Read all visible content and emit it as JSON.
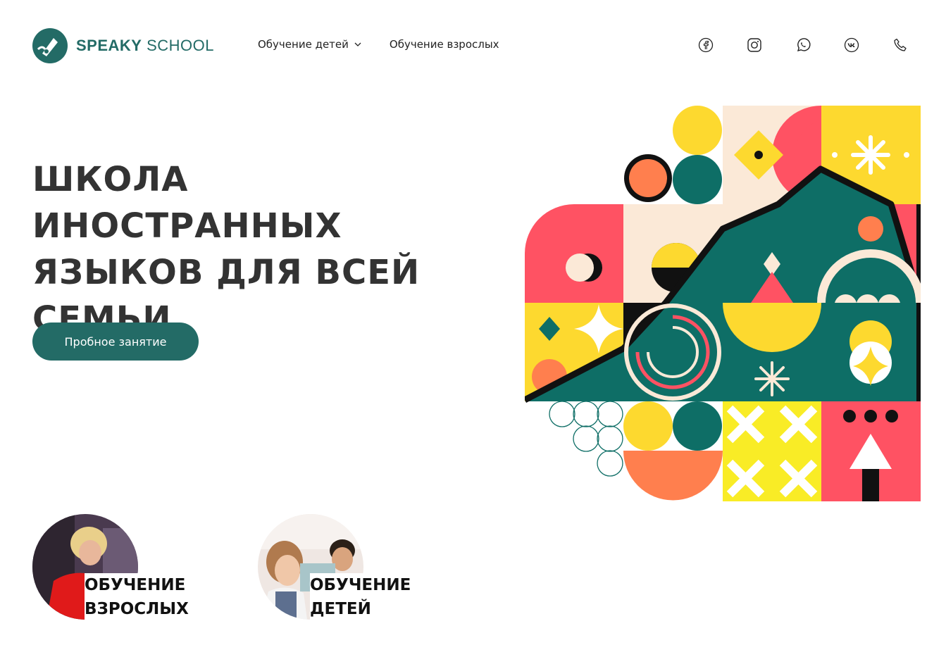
{
  "brand": {
    "name_bold": "SPEAKY",
    "name_light": "SCHOOL",
    "accent": "#236b66"
  },
  "nav": {
    "items": [
      {
        "label": "Обучение детей",
        "has_dropdown": true
      },
      {
        "label": "Обучение взрослых",
        "has_dropdown": false
      }
    ]
  },
  "socials": [
    {
      "icon": "facebook-icon"
    },
    {
      "icon": "instagram-icon"
    },
    {
      "icon": "whatsapp-icon"
    },
    {
      "icon": "vk-icon"
    },
    {
      "icon": "phone-icon"
    }
  ],
  "hero": {
    "title_lines": [
      "ШКОЛА ИНОСТРАННЫХ",
      "ЯЗЫКОВ ДЛЯ ВСЕЙ",
      "СЕМЬИ"
    ],
    "cta_label": "Пробное занятие"
  },
  "cards": [
    {
      "line1": "ОБУЧЕНИЕ",
      "line2": "ВЗРОСЛЫХ"
    },
    {
      "line1": "ОБУЧЕНИЕ",
      "line2": "ДЕТЕЙ"
    }
  ],
  "colors": {
    "teal": "#0e6e66",
    "yellow": "#fdd92f",
    "coral": "#ff5263",
    "orange": "#ff7f4e",
    "cream": "#fbe9d7",
    "black": "#111111"
  }
}
